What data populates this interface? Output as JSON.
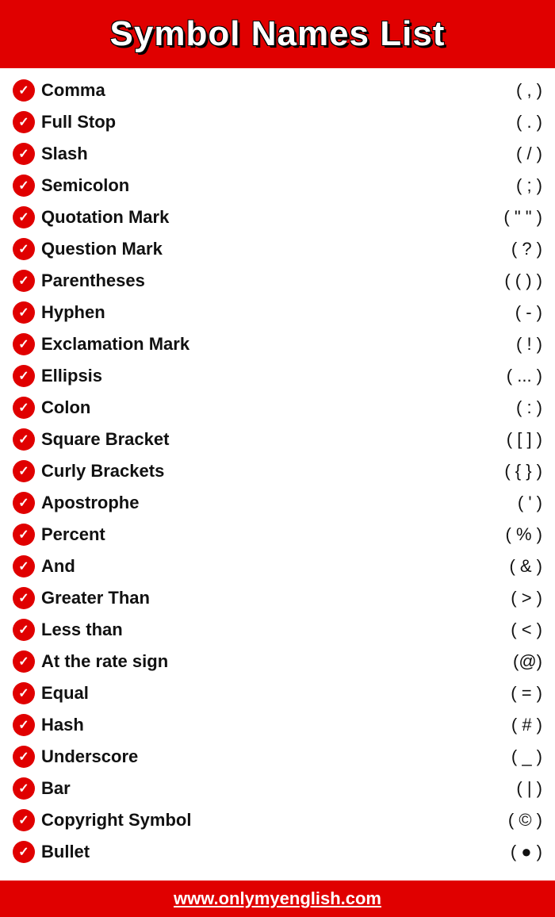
{
  "header": {
    "title": "Symbol Names List"
  },
  "symbols": [
    {
      "name": "Comma",
      "value": "( , )"
    },
    {
      "name": "Full Stop",
      "value": "( . )"
    },
    {
      "name": "Slash",
      "value": "( / )"
    },
    {
      "name": "Semicolon",
      "value": "( ; )"
    },
    {
      "name": "Quotation Mark",
      "value": "( \" \" )"
    },
    {
      "name": "Question Mark",
      "value": "( ? )"
    },
    {
      "name": "Parentheses",
      "value": "( ( ) )"
    },
    {
      "name": "Hyphen",
      "value": "( - )"
    },
    {
      "name": "Exclamation Mark",
      "value": "( ! )"
    },
    {
      "name": "Ellipsis",
      "value": "( ... )"
    },
    {
      "name": "Colon",
      "value": "( : )"
    },
    {
      "name": "Square Bracket",
      "value": "( [ ] )"
    },
    {
      "name": "Curly Brackets",
      "value": "( { } )"
    },
    {
      "name": "Apostrophe",
      "value": "( ' )"
    },
    {
      "name": "Percent",
      "value": "( % )"
    },
    {
      "name": "And",
      "value": "( & )"
    },
    {
      "name": "Greater Than",
      "value": "( > )"
    },
    {
      "name": "Less than",
      "value": "( < )"
    },
    {
      "name": "At the rate sign",
      "value": "(@)"
    },
    {
      "name": "Equal",
      "value": "( = )"
    },
    {
      "name": "Hash",
      "value": "( # )"
    },
    {
      "name": "Underscore",
      "value": "( _ )"
    },
    {
      "name": "Bar",
      "value": "( | )"
    },
    {
      "name": "Copyright Symbol",
      "value": "( © )"
    },
    {
      "name": "Bullet",
      "value": "( ● )"
    }
  ],
  "footer": {
    "url": "www.onlymyenglish.com"
  }
}
